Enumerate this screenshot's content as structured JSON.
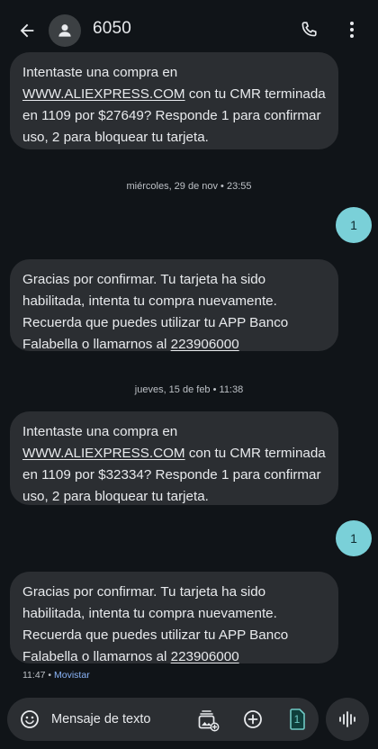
{
  "header": {
    "contact_name": "6050",
    "icons": {
      "back": "arrow-back-icon",
      "avatar": "person-icon",
      "call": "phone-icon",
      "more": "more-vert-icon"
    }
  },
  "messages": [
    {
      "type": "incoming",
      "line1": "Intentaste una compra en",
      "link": "WWW.ALIEXPRESS.COM",
      "line2_rest": " con tu CMR terminada",
      "line3": "en 1109 por $27649? Responde 1 para confirmar",
      "line4": "uso, 2 para bloquear tu tarjeta."
    },
    {
      "type": "date",
      "text": "miércoles, 29 de nov • 23:55"
    },
    {
      "type": "outgoing",
      "text": "1"
    },
    {
      "type": "incoming",
      "line1": "Gracias por confirmar. Tu tarjeta ha sido",
      "line2": "habilitada, intenta tu compra nuevamente.",
      "line3": "Recuerda que puedes utilizar tu APP Banco",
      "line4_pre": "Falabella o llamarnos al ",
      "phone": "223906000"
    },
    {
      "type": "date",
      "text": "jueves, 15 de feb • 11:38"
    },
    {
      "type": "incoming",
      "line1": "Intentaste una compra en",
      "link": "WWW.ALIEXPRESS.COM",
      "line2_rest": " con tu CMR terminada",
      "line3": "en 1109 por $32334? Responde 1 para confirmar",
      "line4": "uso, 2 para bloquear tu tarjeta."
    },
    {
      "type": "outgoing",
      "text": "1"
    },
    {
      "type": "incoming",
      "line1": "Gracias por confirmar. Tu tarjeta ha sido",
      "line2": "habilitada, intenta tu compra nuevamente.",
      "line3": "Recuerda que puedes utilizar tu APP Banco",
      "line4_pre": "Falabella o llamarnos al ",
      "phone": "223906000"
    }
  ],
  "status": {
    "time": "11:47",
    "separator": " • ",
    "carrier": "Movistar"
  },
  "compose": {
    "placeholder": "Mensaje de texto",
    "sim_label": "1",
    "icons": {
      "emoji": "emoji-icon",
      "gallery": "gallery-icon",
      "add": "add-circle-icon",
      "sim": "sim-card-icon",
      "voice": "voice-waveform-icon"
    }
  },
  "colors": {
    "background": "#101418",
    "incoming_bubble": "#2b2e32",
    "outgoing_bubble": "#7ad0d8",
    "carrier_text": "#8ab4f8",
    "sim_icon": "#6fc9c4"
  }
}
